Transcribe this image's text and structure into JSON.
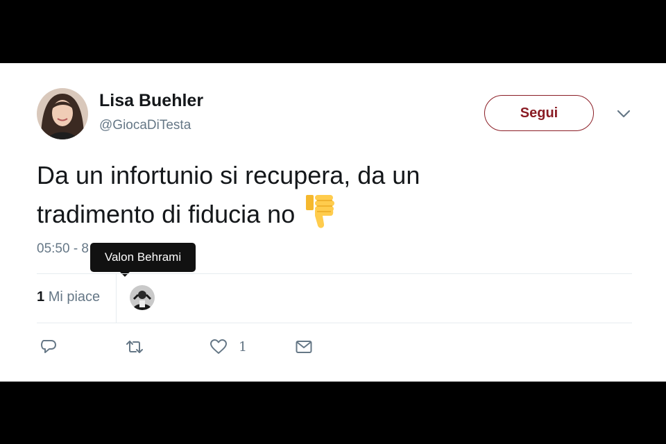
{
  "tweet": {
    "author": {
      "name": "Lisa Buehler",
      "handle": "@GiocaDiTesta"
    },
    "follow_label": "Segui",
    "text_line1": "Da un infortunio si recupera, da un",
    "text_line2": "tradimento di fiducia no",
    "emoji_icon": "thumbs-down-icon",
    "timestamp": "05:50 - 8"
  },
  "tooltip": {
    "text": "Valon Behrami"
  },
  "stats": {
    "likes_count": "1",
    "likes_label": "Mi piace"
  },
  "actions": {
    "reply_icon": "reply-icon",
    "retweet_icon": "retweet-icon",
    "like_icon": "heart-icon",
    "like_count": "1",
    "message_icon": "envelope-icon"
  },
  "colors": {
    "follow_accent": "#8a1c24",
    "secondary_text": "#657786",
    "primary_text": "#14171a"
  }
}
